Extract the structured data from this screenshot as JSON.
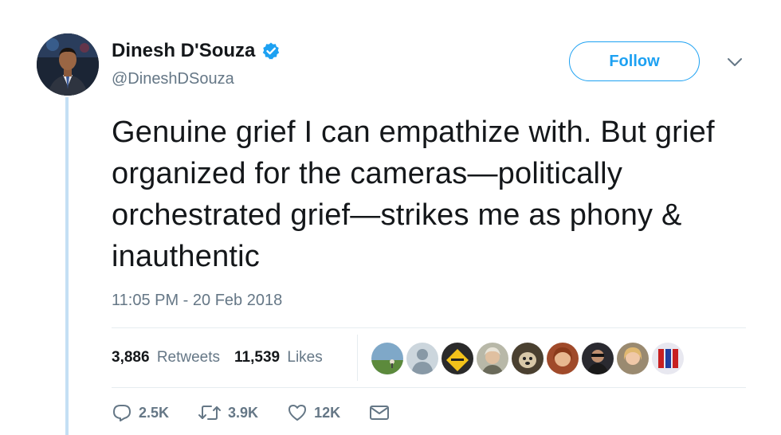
{
  "author": {
    "display_name": "Dinesh D'Souza",
    "handle": "@DineshDSouza",
    "verified": true
  },
  "follow_button": {
    "label": "Follow"
  },
  "tweet": {
    "text": "Genuine grief I can empathize with. But grief organized for the cameras—politically orchestrated grief—strikes me as phony & inauthentic",
    "timestamp": "11:05 PM - 20 Feb 2018"
  },
  "stats": {
    "retweets_count": "3,886",
    "retweets_label": "Retweets",
    "likes_count": "11,539",
    "likes_label": "Likes"
  },
  "likers": [
    {
      "icon": "liker-avatar-landscape"
    },
    {
      "icon": "liker-avatar-default"
    },
    {
      "icon": "liker-avatar-sign"
    },
    {
      "icon": "liker-avatar-woman"
    },
    {
      "icon": "liker-avatar-dog"
    },
    {
      "icon": "liker-avatar-woman-red"
    },
    {
      "icon": "liker-avatar-man-dark"
    },
    {
      "icon": "liker-avatar-woman-blonde"
    },
    {
      "icon": "liker-avatar-flags"
    }
  ],
  "actions": {
    "reply_count": "2.5K",
    "retweet_count": "3.9K",
    "like_count": "12K"
  },
  "colors": {
    "accent": "#1da1f2",
    "secondary_text": "#657786",
    "thread_line": "#c4dff4"
  }
}
